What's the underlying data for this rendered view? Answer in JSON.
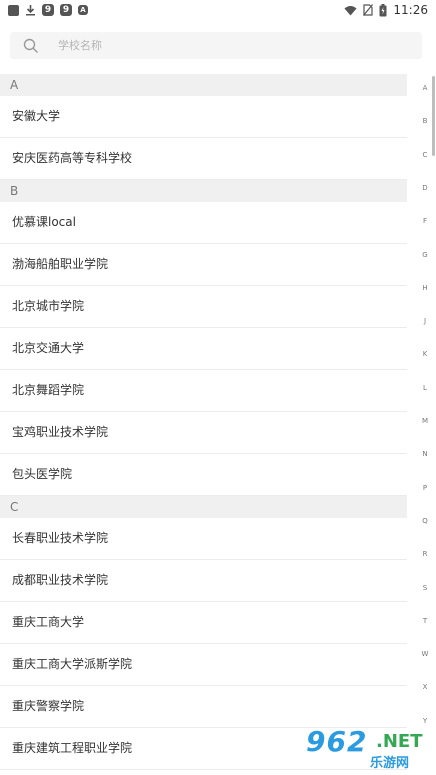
{
  "status_bar": {
    "left_icons": [
      "app-square-icon",
      "download-icon",
      "app-9-icon",
      "app-9-icon",
      "app-a-icon"
    ],
    "app_9_glyph": "9",
    "app_a_glyph": "A",
    "time": "11:26"
  },
  "search": {
    "placeholder": "学校名称",
    "value": ""
  },
  "sections": [
    {
      "letter": "A",
      "items": [
        "安徽大学",
        "安庆医药高等专科学校"
      ]
    },
    {
      "letter": "B",
      "items": [
        "优慕课local",
        "渤海船舶职业学院",
        "北京城市学院",
        "北京交通大学",
        "北京舞蹈学院",
        "宝鸡职业技术学院",
        "包头医学院"
      ]
    },
    {
      "letter": "C",
      "items": [
        "长春职业技术学院",
        "成都职业技术学院",
        "重庆工商大学",
        "重庆工商大学派斯学院",
        "重庆警察学院",
        "重庆建筑工程职业学院"
      ]
    }
  ],
  "index_letters": [
    "A",
    "B",
    "C",
    "D",
    "F",
    "G",
    "H",
    "J",
    "K",
    "L",
    "M",
    "N",
    "P",
    "Q",
    "R",
    "S",
    "T",
    "W",
    "X",
    "Y"
  ],
  "watermark": {
    "number": "962",
    "net": ".NET",
    "sub": "乐游网"
  },
  "colors": {
    "header_bg": "#f0f0f0",
    "search_bg": "#f5f5f5",
    "watermark_blue": "#2a9be0",
    "watermark_green": "#34a853"
  }
}
